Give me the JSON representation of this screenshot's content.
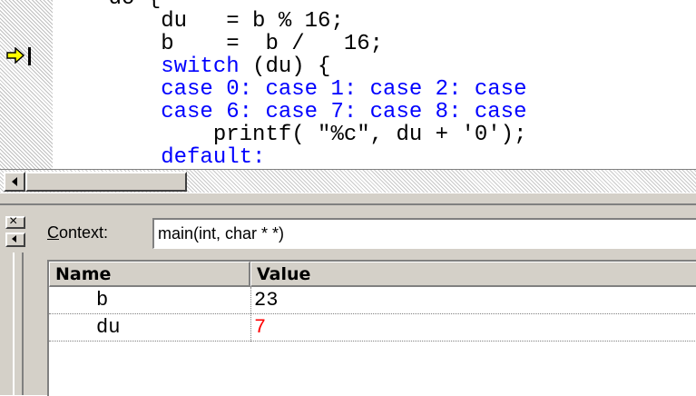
{
  "editor": {
    "lines": [
      {
        "text": "    do {",
        "kw": false
      },
      {
        "text": "        du   = b % 16;",
        "kw": false
      },
      {
        "text": "        b    =  b /   16;",
        "kw": false
      },
      {
        "text": "        switch (du) {",
        "kw": true,
        "kw_word": "switch"
      },
      {
        "text": "        case 0: case 1: case 2: case",
        "kw": true,
        "kw_all": true
      },
      {
        "text": "        case 6: case 7: case 8: case",
        "kw": true,
        "kw_all": true
      },
      {
        "text": "            printf( \"%c\", du + '0');",
        "kw": false
      },
      {
        "text": "        default:",
        "kw": true,
        "kw_all": true
      }
    ],
    "current_line_marker": "arrow-icon"
  },
  "locals": {
    "context_label_prefix": "C",
    "context_label_rest": "ontext:",
    "context_value": "main(int, char * *)",
    "columns": {
      "name": "Name",
      "value": "Value"
    },
    "rows": [
      {
        "name": "b",
        "value": "23",
        "color": "#000000"
      },
      {
        "name": "du",
        "value": "7",
        "color": "#ff0000"
      }
    ]
  },
  "colors": {
    "keyword": "#0000ff",
    "changed_value": "#ff0000",
    "panel": "#d4d0c8"
  }
}
